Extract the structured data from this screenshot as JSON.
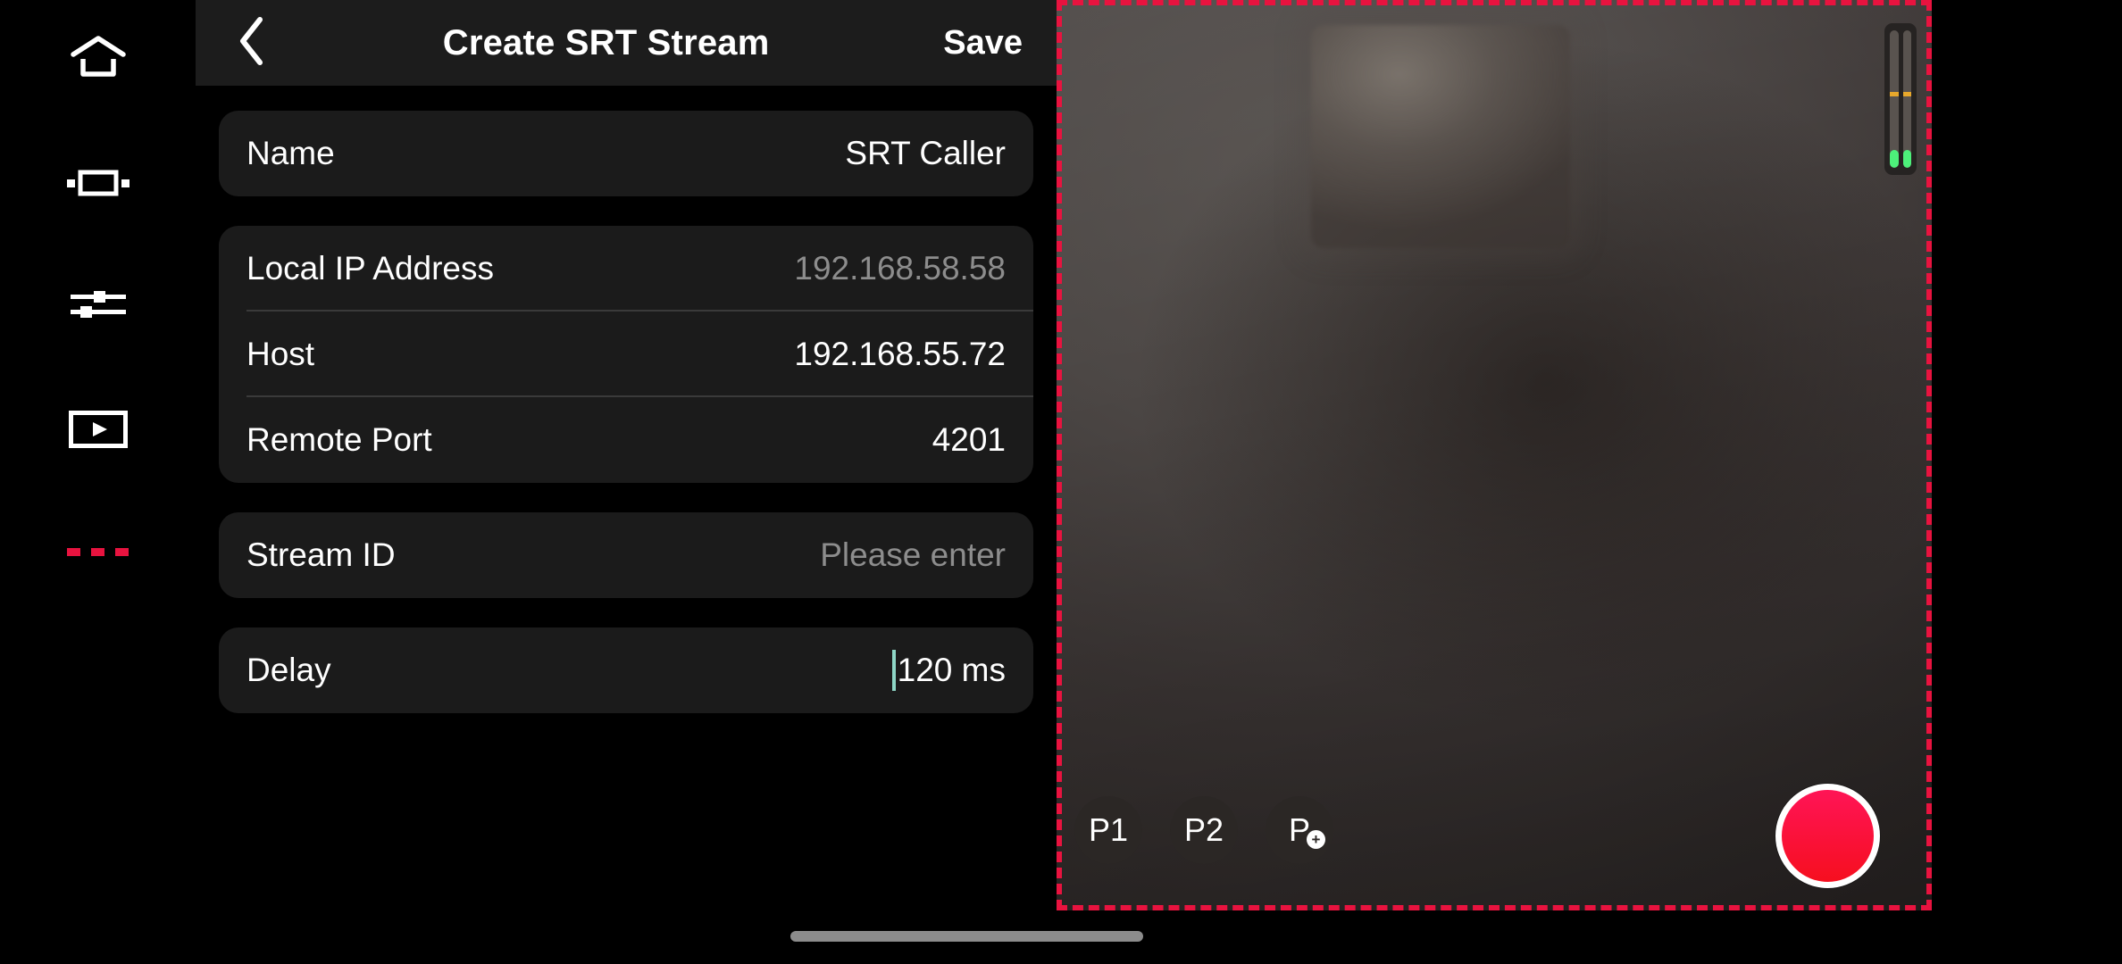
{
  "sidebar": {
    "items": [
      {
        "name": "home",
        "icon": "home-icon"
      },
      {
        "name": "device",
        "icon": "device-frame-icon"
      },
      {
        "name": "settings",
        "icon": "sliders-icon"
      },
      {
        "name": "playback",
        "icon": "video-play-icon"
      },
      {
        "name": "more",
        "icon": "more-dots-icon"
      }
    ],
    "more_accent": "#e8133f"
  },
  "header": {
    "title": "Create SRT Stream",
    "save_label": "Save",
    "back_icon": "chevron-left-icon"
  },
  "form": {
    "groups": [
      {
        "rows": [
          {
            "label": "Name",
            "value": "SRT Caller",
            "muted": false,
            "editable": true
          }
        ]
      },
      {
        "rows": [
          {
            "label": "Local IP Address",
            "value": "192.168.58.58",
            "muted": true,
            "editable": false
          },
          {
            "label": "Host",
            "value": "192.168.55.72",
            "muted": false,
            "editable": true
          },
          {
            "label": "Remote Port",
            "value": "4201",
            "muted": false,
            "editable": true
          }
        ]
      },
      {
        "rows": [
          {
            "label": "Stream ID",
            "value": "Please enter",
            "muted": true,
            "editable": true,
            "is_placeholder": true
          }
        ]
      },
      {
        "rows": [
          {
            "label": "Delay",
            "value": "120 ms",
            "muted": false,
            "editable": true,
            "focused": true
          }
        ]
      }
    ]
  },
  "preview": {
    "recording_border_color": "#e8133f",
    "audio_meter": {
      "channels": [
        {
          "level_pct": 13,
          "peak_pct": 52
        },
        {
          "level_pct": 13,
          "peak_pct": 52
        }
      ],
      "level_color": "#4df07a",
      "peak_color": "#e8a82c"
    },
    "presets": [
      {
        "label": "P1",
        "has_plus": false
      },
      {
        "label": "P2",
        "has_plus": false
      },
      {
        "label": "P",
        "has_plus": true,
        "plus_glyph": "+"
      }
    ],
    "record_button": {
      "icon": "record-circle-icon",
      "color": "#ff1456"
    }
  },
  "system": {
    "home_gesture_bar": "home-gesture-bar"
  }
}
